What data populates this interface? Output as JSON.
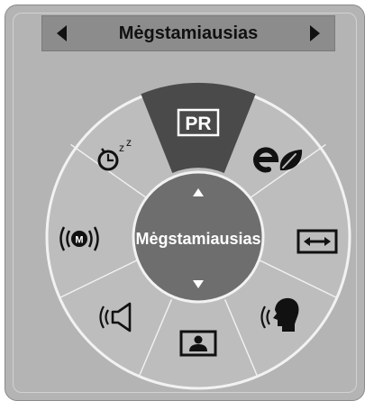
{
  "header": {
    "title": "Mėgstamiausias",
    "prev_icon": "triangle-left-icon",
    "next_icon": "triangle-right-icon"
  },
  "dial": {
    "center_label": "Mėgstamiausias",
    "up_icon": "triangle-up-icon",
    "down_icon": "triangle-down-icon",
    "selected": "PR",
    "items": [
      {
        "name": "program-list",
        "icon": "pr-icon",
        "label": "PR"
      },
      {
        "name": "energy-saving",
        "icon": "eco-icon"
      },
      {
        "name": "aspect-ratio",
        "icon": "aspect-ratio-icon"
      },
      {
        "name": "voice-clarity",
        "icon": "voice-icon"
      },
      {
        "name": "picture-mode",
        "icon": "picture-icon"
      },
      {
        "name": "sound-mode",
        "icon": "speaker-icon"
      },
      {
        "name": "multi-audio",
        "icon": "m-sound-icon"
      },
      {
        "name": "sleep-timer",
        "icon": "sleep-timer-icon"
      }
    ]
  },
  "colors": {
    "panel": "#b4b4b4",
    "dial": "#bdbdbd",
    "selected": "#4a4a4a",
    "center": "#6e6e6e",
    "icon": "#111111"
  }
}
